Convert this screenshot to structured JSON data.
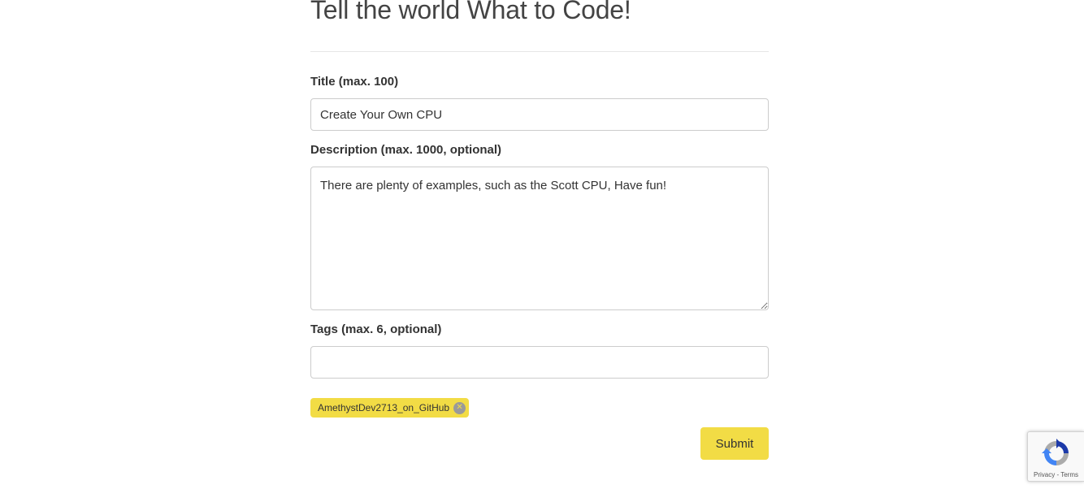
{
  "page": {
    "title": "Tell the world What to Code!"
  },
  "form": {
    "title_label": "Title (max. 100)",
    "title_value": "Create Your Own CPU",
    "description_label": "Description (max. 1000, optional)",
    "description_value": "There are plenty of examples, such as the Scott CPU, Have fun!",
    "tags_label": "Tags (max. 6, optional)",
    "tags_value": "",
    "tags": [
      {
        "label": "AmethystDev2713_on_GitHub",
        "remove_icon": "close-circle-icon"
      }
    ],
    "submit_label": "Submit"
  },
  "recaptcha": {
    "privacy": "Privacy",
    "separator": " - ",
    "terms": "Terms"
  },
  "colors": {
    "accent": "#f2dc45",
    "text": "#333333",
    "border": "#cccccc"
  }
}
